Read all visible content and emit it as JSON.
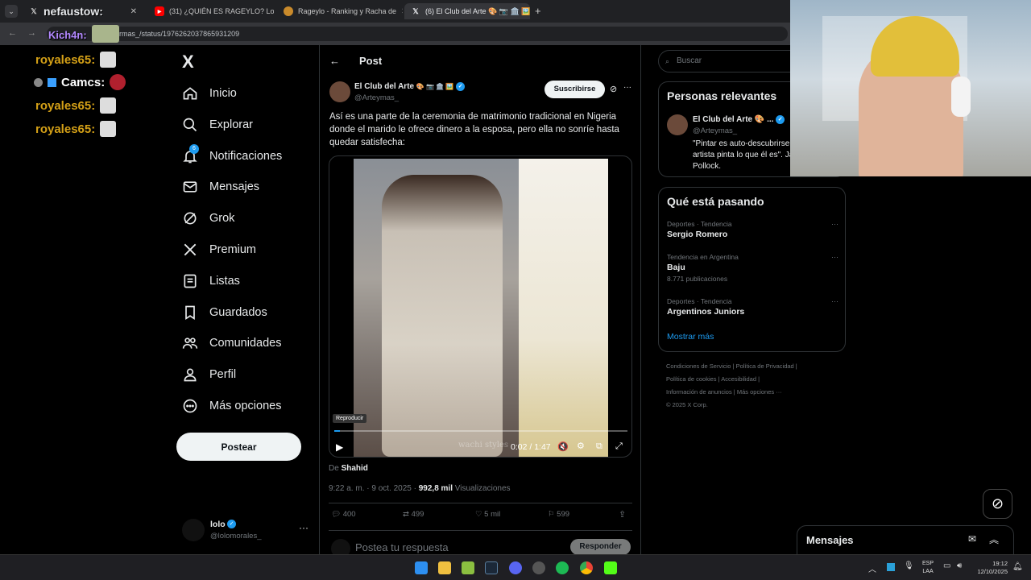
{
  "browser": {
    "tabs": [
      {
        "label": "nefaustow:",
        "favicon": "x-logo-icon"
      },
      {
        "label": "(31) ¿QUIÉN ES RAGEYLO? Lolo",
        "favicon": "youtube-icon"
      },
      {
        "label": "Rageylo - Ranking y Racha de",
        "favicon": "rageylo-icon"
      },
      {
        "label": "(6) El Club del Arte 🎨 📷 🏛️ 🖼️",
        "favicon": "x-logo-icon"
      }
    ],
    "url": "rmas_/status/1976262037865931209",
    "overlay_user": "Kich4n:"
  },
  "chat": [
    {
      "user": "royales65:",
      "color": "#d4a017"
    },
    {
      "user": "Camcs:",
      "color": "#ffffff"
    },
    {
      "user": "royales65:",
      "color": "#d4a017"
    },
    {
      "user": "royales65:",
      "color": "#d4a017"
    }
  ],
  "sidebar": {
    "logo": "X",
    "items": [
      {
        "label": "Inicio",
        "icon": "home-icon"
      },
      {
        "label": "Explorar",
        "icon": "search-icon"
      },
      {
        "label": "Notificaciones",
        "icon": "bell-icon"
      },
      {
        "label": "Mensajes",
        "icon": "mail-icon"
      },
      {
        "label": "Grok",
        "icon": "grok-icon"
      },
      {
        "label": "Premium",
        "icon": "x-premium-icon"
      },
      {
        "label": "Listas",
        "icon": "list-icon"
      },
      {
        "label": "Guardados",
        "icon": "bookmark-icon"
      },
      {
        "label": "Comunidades",
        "icon": "communities-icon"
      },
      {
        "label": "Perfil",
        "icon": "user-icon"
      },
      {
        "label": "Más opciones",
        "icon": "more-circle-icon"
      }
    ],
    "notif_badge": "6",
    "post_button": "Postear",
    "account": {
      "name": "lolo",
      "handle": "@lolomorales_"
    }
  },
  "post": {
    "header_title": "Post",
    "author_name": "El Club del Arte",
    "author_emojis": "🎨 📷 🏛️ 🖼️",
    "author_handle": "@Arteymas_",
    "subscribe": "Suscribirse",
    "text": "Así es una parte de la ceremonia de matrimonio tradicional en Nigeria donde el marido le ofrece dinero a la esposa, pero ella no sonríe hasta quedar satisfecha:",
    "video": {
      "tooltip": "Reproducir",
      "time": "0:02 / 1:47",
      "progress": 0.02,
      "watermark": "wachi styles"
    },
    "source_prefix": "De",
    "source_name": "Shahid",
    "time": "9:22 a. m. · 9 oct. 2025 ·",
    "views_count": "992,8 mil",
    "views_label": "Visualizaciones",
    "stats": {
      "replies": "400",
      "reposts": "499",
      "likes": "5 mil",
      "bookmarks": "599"
    },
    "reply_placeholder": "Postea tu respuesta",
    "reply_button": "Responder"
  },
  "right": {
    "search_placeholder": "Buscar",
    "relevant_title": "Personas relevantes",
    "relevant_name": "El Club del Arte 🎨 ...",
    "relevant_handle": "@Arteymas_",
    "relevant_bio": "\"Pintar es auto-descubrirse. Todo buen artista pinta lo que él es\". Jackson Pollock.",
    "trends_title": "Qué está pasando",
    "trends": [
      {
        "category": "Deportes · Tendencia",
        "name": "Sergio Romero",
        "count": ""
      },
      {
        "category": "Tendencia en Argentina",
        "name": "Baju",
        "count": "8.771 publicaciones"
      },
      {
        "category": "Deportes · Tendencia",
        "name": "Argentinos Juniors",
        "count": ""
      }
    ],
    "show_more": "Mostrar más",
    "footer": [
      "Condiciones de Servicio",
      "Política de Privacidad",
      "Política de cookies",
      "Accesibilidad",
      "Información de anuncios",
      "Más opciones ···",
      "© 2025 X Corp."
    ],
    "messages_title": "Mensajes"
  },
  "taskbar": {
    "lang": "ESP",
    "lang2": "LAA",
    "time": "19:12",
    "date": "12/10/2025"
  },
  "colors": {
    "accent": "#1d9bf0",
    "bg": "#000000",
    "border": "#2f3336",
    "chat_name": "#d4a017"
  }
}
